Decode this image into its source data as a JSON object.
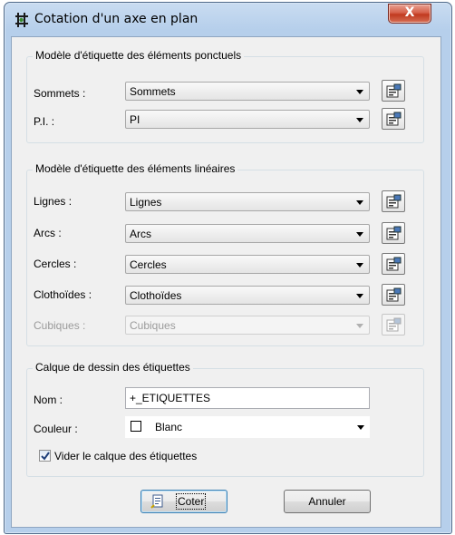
{
  "window": {
    "title": "Cotation d'un axe en plan",
    "close_label": "X"
  },
  "group_ponctuels": {
    "title": "Modèle d'étiquette des éléments ponctuels",
    "rows": [
      {
        "label": "Sommets :",
        "value": "Sommets"
      },
      {
        "label": "P.I. :",
        "value": "PI"
      }
    ]
  },
  "group_lineaires": {
    "title": "Modèle d'étiquette des éléments linéaires",
    "rows": [
      {
        "label": "Lignes :",
        "value": "Lignes"
      },
      {
        "label": "Arcs :",
        "value": "Arcs"
      },
      {
        "label": "Cercles :",
        "value": "Cercles"
      },
      {
        "label": "Clothoïdes :",
        "value": "Clothoïdes"
      },
      {
        "label": "Cubiques :",
        "value": "Cubiques",
        "disabled": true
      }
    ]
  },
  "group_calque": {
    "title": "Calque de dessin des étiquettes",
    "nom_label": "Nom :",
    "nom_value": "+_ETIQUETTES",
    "couleur_label": "Couleur :",
    "couleur_value": "Blanc",
    "checkbox_label": "Vider le calque des étiquettes",
    "checkbox_checked": true
  },
  "buttons": {
    "ok": "Coter",
    "cancel": "Annuler"
  },
  "colors": {
    "client_bg": "#f0f0f0",
    "title_bar": "#b6cfeb",
    "close": "#c0391f",
    "swatch": "#ffffff"
  }
}
